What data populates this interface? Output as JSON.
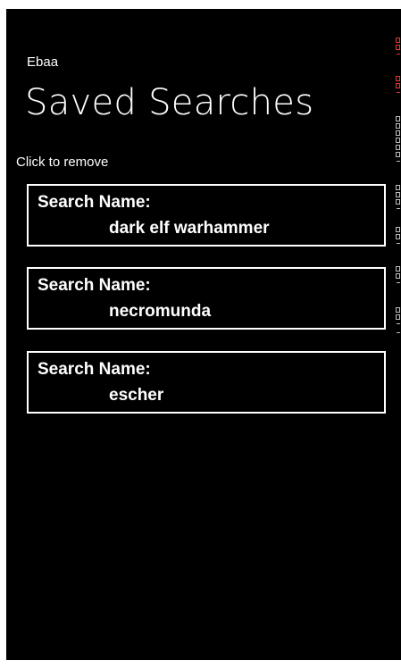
{
  "app": {
    "name": "Ebaa"
  },
  "page": {
    "title": "Saved Searches",
    "hint": "Click to remove"
  },
  "searches": [
    {
      "label": "Search Name:",
      "value": "dark elf warhammer"
    },
    {
      "label": "Search Name:",
      "value": "necromunda"
    },
    {
      "label": "Search Name:",
      "value": "escher"
    }
  ],
  "colors": {
    "background": "#000000",
    "foreground": "#ffffff",
    "accent": "#e23b2e"
  }
}
